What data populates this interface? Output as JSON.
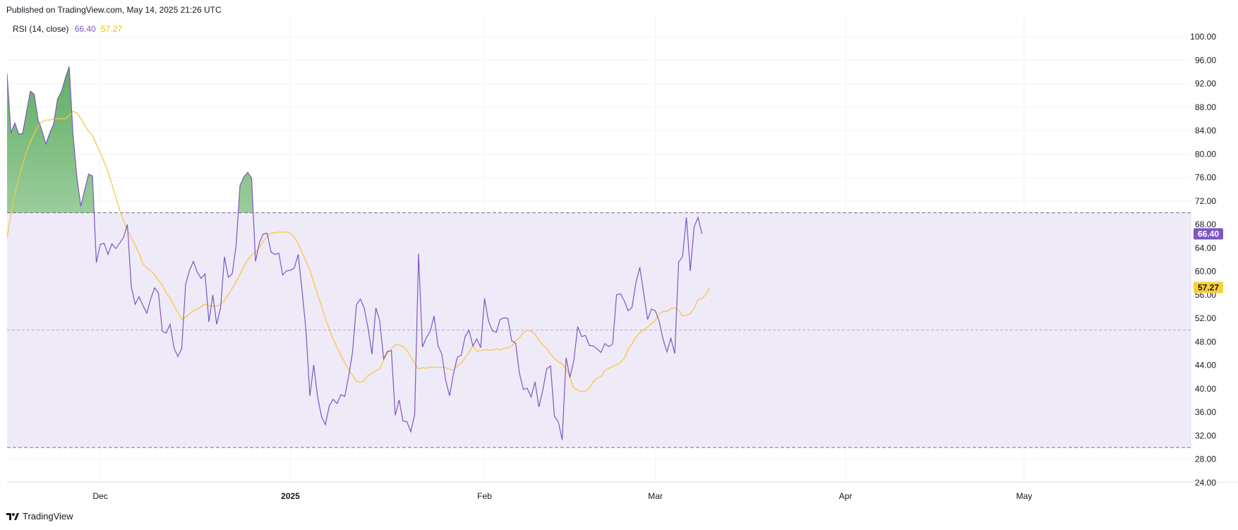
{
  "header": {
    "published": "Published on TradingView.com, May 14, 2025 21:26 UTC"
  },
  "legend": {
    "name": "RSI (14, close)",
    "rsi_value": "66.40",
    "ma_value": "57.27"
  },
  "footer": {
    "brand": "TradingView"
  },
  "colors": {
    "rsi": "#7e57c2",
    "ma": "#f7c843",
    "band_fill": "#efeaf8",
    "overbought_fill": "#43a047",
    "rsi_badge": "#7e57c2",
    "ma_badge": "#f7d139"
  },
  "chart_data": {
    "type": "line",
    "ylim": [
      24,
      100
    ],
    "y_ticks": [
      "100.00",
      "96.00",
      "92.00",
      "88.00",
      "84.00",
      "80.00",
      "76.00",
      "72.00",
      "68.00",
      "64.00",
      "60.00",
      "56.00",
      "52.00",
      "48.00",
      "44.00",
      "40.00",
      "36.00",
      "32.00",
      "28.00",
      "24.00"
    ],
    "x_ticks": [
      {
        "label": "Dec",
        "i": 24,
        "bold": false
      },
      {
        "label": "2025",
        "i": 73,
        "bold": true
      },
      {
        "label": "Feb",
        "i": 123,
        "bold": false
      },
      {
        "label": "Mar",
        "i": 167,
        "bold": false
      },
      {
        "label": "Apr",
        "i": 216,
        "bold": false
      },
      {
        "label": "May",
        "i": 262,
        "bold": false
      }
    ],
    "bands": {
      "upper": 70,
      "middle": 50,
      "lower": 30
    },
    "last_values": {
      "rsi": 66.4,
      "ma": 57.27
    },
    "series": [
      {
        "name": "RSI",
        "values": [
          93.7,
          83.6,
          85.3,
          83.4,
          83.5,
          87.1,
          90.7,
          90.2,
          85.8,
          84.0,
          81.7,
          83.6,
          85.1,
          89.4,
          90.6,
          92.9,
          94.9,
          83.3,
          76.0,
          71.1,
          73.9,
          76.6,
          76.3,
          61.5,
          64.6,
          64.8,
          62.9,
          64.7,
          63.9,
          64.8,
          65.8,
          68.0,
          57.4,
          54.4,
          55.7,
          54.2,
          52.9,
          55.3,
          57.2,
          56.3,
          49.8,
          49.5,
          51.0,
          47.0,
          45.5,
          46.9,
          57.8,
          60.2,
          61.7,
          59.9,
          58.8,
          59.6,
          51.4,
          56.0,
          51.0,
          53.8,
          62.5,
          59.0,
          59.6,
          64.4,
          74.6,
          76.1,
          76.9,
          75.9,
          61.7,
          64.9,
          66.4,
          66.5,
          63.3,
          62.9,
          63.1,
          59.4,
          60.1,
          60.2,
          60.6,
          62.9,
          56.7,
          50.0,
          38.8,
          44.1,
          38.6,
          35.3,
          33.9,
          37.1,
          38.2,
          37.5,
          39.0,
          38.7,
          42.2,
          46.3,
          54.3,
          55.3,
          53.8,
          50.3,
          45.9,
          53.8,
          51.6,
          45.1,
          46.4,
          46.5,
          35.5,
          38.1,
          34.5,
          34.4,
          32.7,
          35.6,
          63.0,
          47.1,
          48.7,
          49.8,
          52.4,
          47.4,
          45.9,
          41.4,
          38.8,
          42.6,
          45.4,
          45.7,
          48.9,
          50.0,
          47.3,
          48.5,
          47.0,
          55.4,
          51.6,
          49.9,
          49.6,
          51.8,
          52.1,
          52.0,
          48.2,
          47.8,
          42.6,
          39.9,
          40.1,
          38.6,
          41.2,
          36.9,
          39.7,
          43.4,
          43.9,
          35.3,
          34.4,
          31.3,
          45.3,
          41.9,
          44.8,
          50.6,
          48.9,
          49.1,
          47.4,
          47.3,
          46.8,
          46.2,
          47.7,
          47.2,
          47.6,
          56.0,
          56.2,
          55.0,
          53.3,
          53.9,
          58.1,
          60.7,
          56.3,
          51.8,
          53.6,
          53.3,
          51.5,
          48.4,
          46.3,
          48.6,
          46.0,
          61.6,
          62.5,
          69.2,
          60.1,
          67.6,
          69.2,
          66.4
        ],
        "color": "#7e57c2"
      },
      {
        "name": "MA",
        "values": [
          65.8,
          69.6,
          73.1,
          75.9,
          78.3,
          80.3,
          82.1,
          83.5,
          84.7,
          85.5,
          85.8,
          85.8,
          86.0,
          86.0,
          86.1,
          86.0,
          86.6,
          87.3,
          87.0,
          86.1,
          84.9,
          83.9,
          83.2,
          81.7,
          80.3,
          78.7,
          76.9,
          74.9,
          72.7,
          70.5,
          68.7,
          67.1,
          65.8,
          64.5,
          63.1,
          61.3,
          60.6,
          60.1,
          59.4,
          58.5,
          57.6,
          56.4,
          55.4,
          54.2,
          53.0,
          51.8,
          52.2,
          52.8,
          53.3,
          53.6,
          54.0,
          54.4,
          54.2,
          54.1,
          54.1,
          54.3,
          55.1,
          56.1,
          57.1,
          58.3,
          59.5,
          60.8,
          62.0,
          62.8,
          63.2,
          64.1,
          65.1,
          66.0,
          66.5,
          66.6,
          66.7,
          66.7,
          66.7,
          66.5,
          65.8,
          64.7,
          63.2,
          61.8,
          60.2,
          58.1,
          56.1,
          54.1,
          52.0,
          50.2,
          48.5,
          47.1,
          45.7,
          44.5,
          43.3,
          42.3,
          41.3,
          41.1,
          41.4,
          42.3,
          42.6,
          43.1,
          43.4,
          44.9,
          46.1,
          46.8,
          47.5,
          47.5,
          47.2,
          46.5,
          45.5,
          44.3,
          43.4,
          43.6,
          43.5,
          43.7,
          43.7,
          43.6,
          43.7,
          43.6,
          43.3,
          43.2,
          43.9,
          44.4,
          45.3,
          46.2,
          47.4,
          46.4,
          46.5,
          46.7,
          46.6,
          46.6,
          46.8,
          46.6,
          46.9,
          47.0,
          47.3,
          48.2,
          48.7,
          49.6,
          50.0,
          49.8,
          49.3,
          48.3,
          47.5,
          46.9,
          45.9,
          45.2,
          44.6,
          44.3,
          43.4,
          42.0,
          40.1,
          39.8,
          39.5,
          39.6,
          40.1,
          41.2,
          41.8,
          42.1,
          43.1,
          43.5,
          43.8,
          44.1,
          44.5,
          45.2,
          46.7,
          47.7,
          48.8,
          49.5,
          50.1,
          50.5,
          51.1,
          51.7,
          52.7,
          53.2,
          53.2,
          53.7,
          53.8,
          53.4,
          52.4,
          52.5,
          52.8,
          53.7,
          55.2,
          55.4,
          56.0,
          57.27
        ],
        "color": "#f7c843"
      }
    ]
  }
}
